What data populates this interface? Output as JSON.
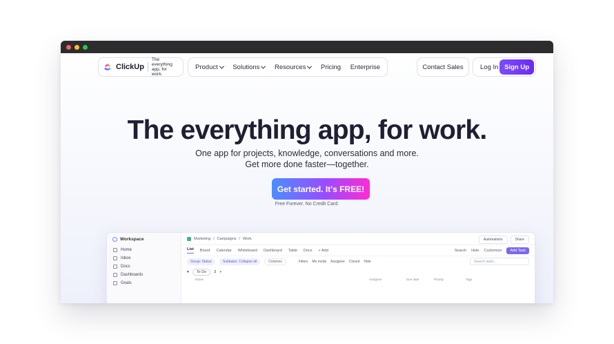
{
  "window": {
    "traffic_lights": [
      "close",
      "minimize",
      "zoom"
    ]
  },
  "nav": {
    "logo_name": "ClickUp",
    "logo_tagline": "The everything app, for work.",
    "menu": [
      {
        "label": "Product",
        "has_dropdown": true
      },
      {
        "label": "Solutions",
        "has_dropdown": true
      },
      {
        "label": "Resources",
        "has_dropdown": true
      },
      {
        "label": "Pricing",
        "has_dropdown": false
      },
      {
        "label": "Enterprise",
        "has_dropdown": false
      }
    ],
    "contact_sales": "Contact Sales",
    "log_in": "Log In",
    "sign_up": "Sign Up"
  },
  "hero": {
    "title": "The everything app, for work.",
    "subtitle_line1": "One app for projects, knowledge, conversations and more.",
    "subtitle_line2": "Get more done faster—together.",
    "cta": "Get started. It's FREE!",
    "cta_note": "Free Forever. No Credit Card."
  },
  "app_preview": {
    "workspace": "Workspace",
    "sidebar": [
      "Home",
      "Inbox",
      "Docs",
      "Dashboards",
      "Goals"
    ],
    "breadcrumbs": [
      "Marketing",
      "/",
      "Campaigns",
      "/",
      "Work"
    ],
    "top_buttons": [
      "Automations",
      "Share"
    ],
    "views": [
      "List",
      "Board",
      "Calendar",
      "Whiteboard",
      "Dashboard",
      "Table",
      "Docs",
      "+ Add"
    ],
    "view_actions": [
      "Search",
      "Hide",
      "Customize"
    ],
    "add_task": "Add Task",
    "filters": [
      "Group: Status",
      "Subtasks: Collapse all",
      "Columns"
    ],
    "filters_right": [
      "Filters",
      "Me mode",
      "Assignee",
      "Closed",
      "Hide"
    ],
    "search_placeholder": "Search tasks...",
    "group_label": "To Do",
    "group_count": "3",
    "columns": [
      "Name",
      "Assignee",
      "Due date",
      "Priority",
      "Tags"
    ]
  },
  "colors": {
    "accent": "#7b4dff",
    "cta_start": "#4b8dff",
    "cta_end": "#ff2bd4"
  }
}
